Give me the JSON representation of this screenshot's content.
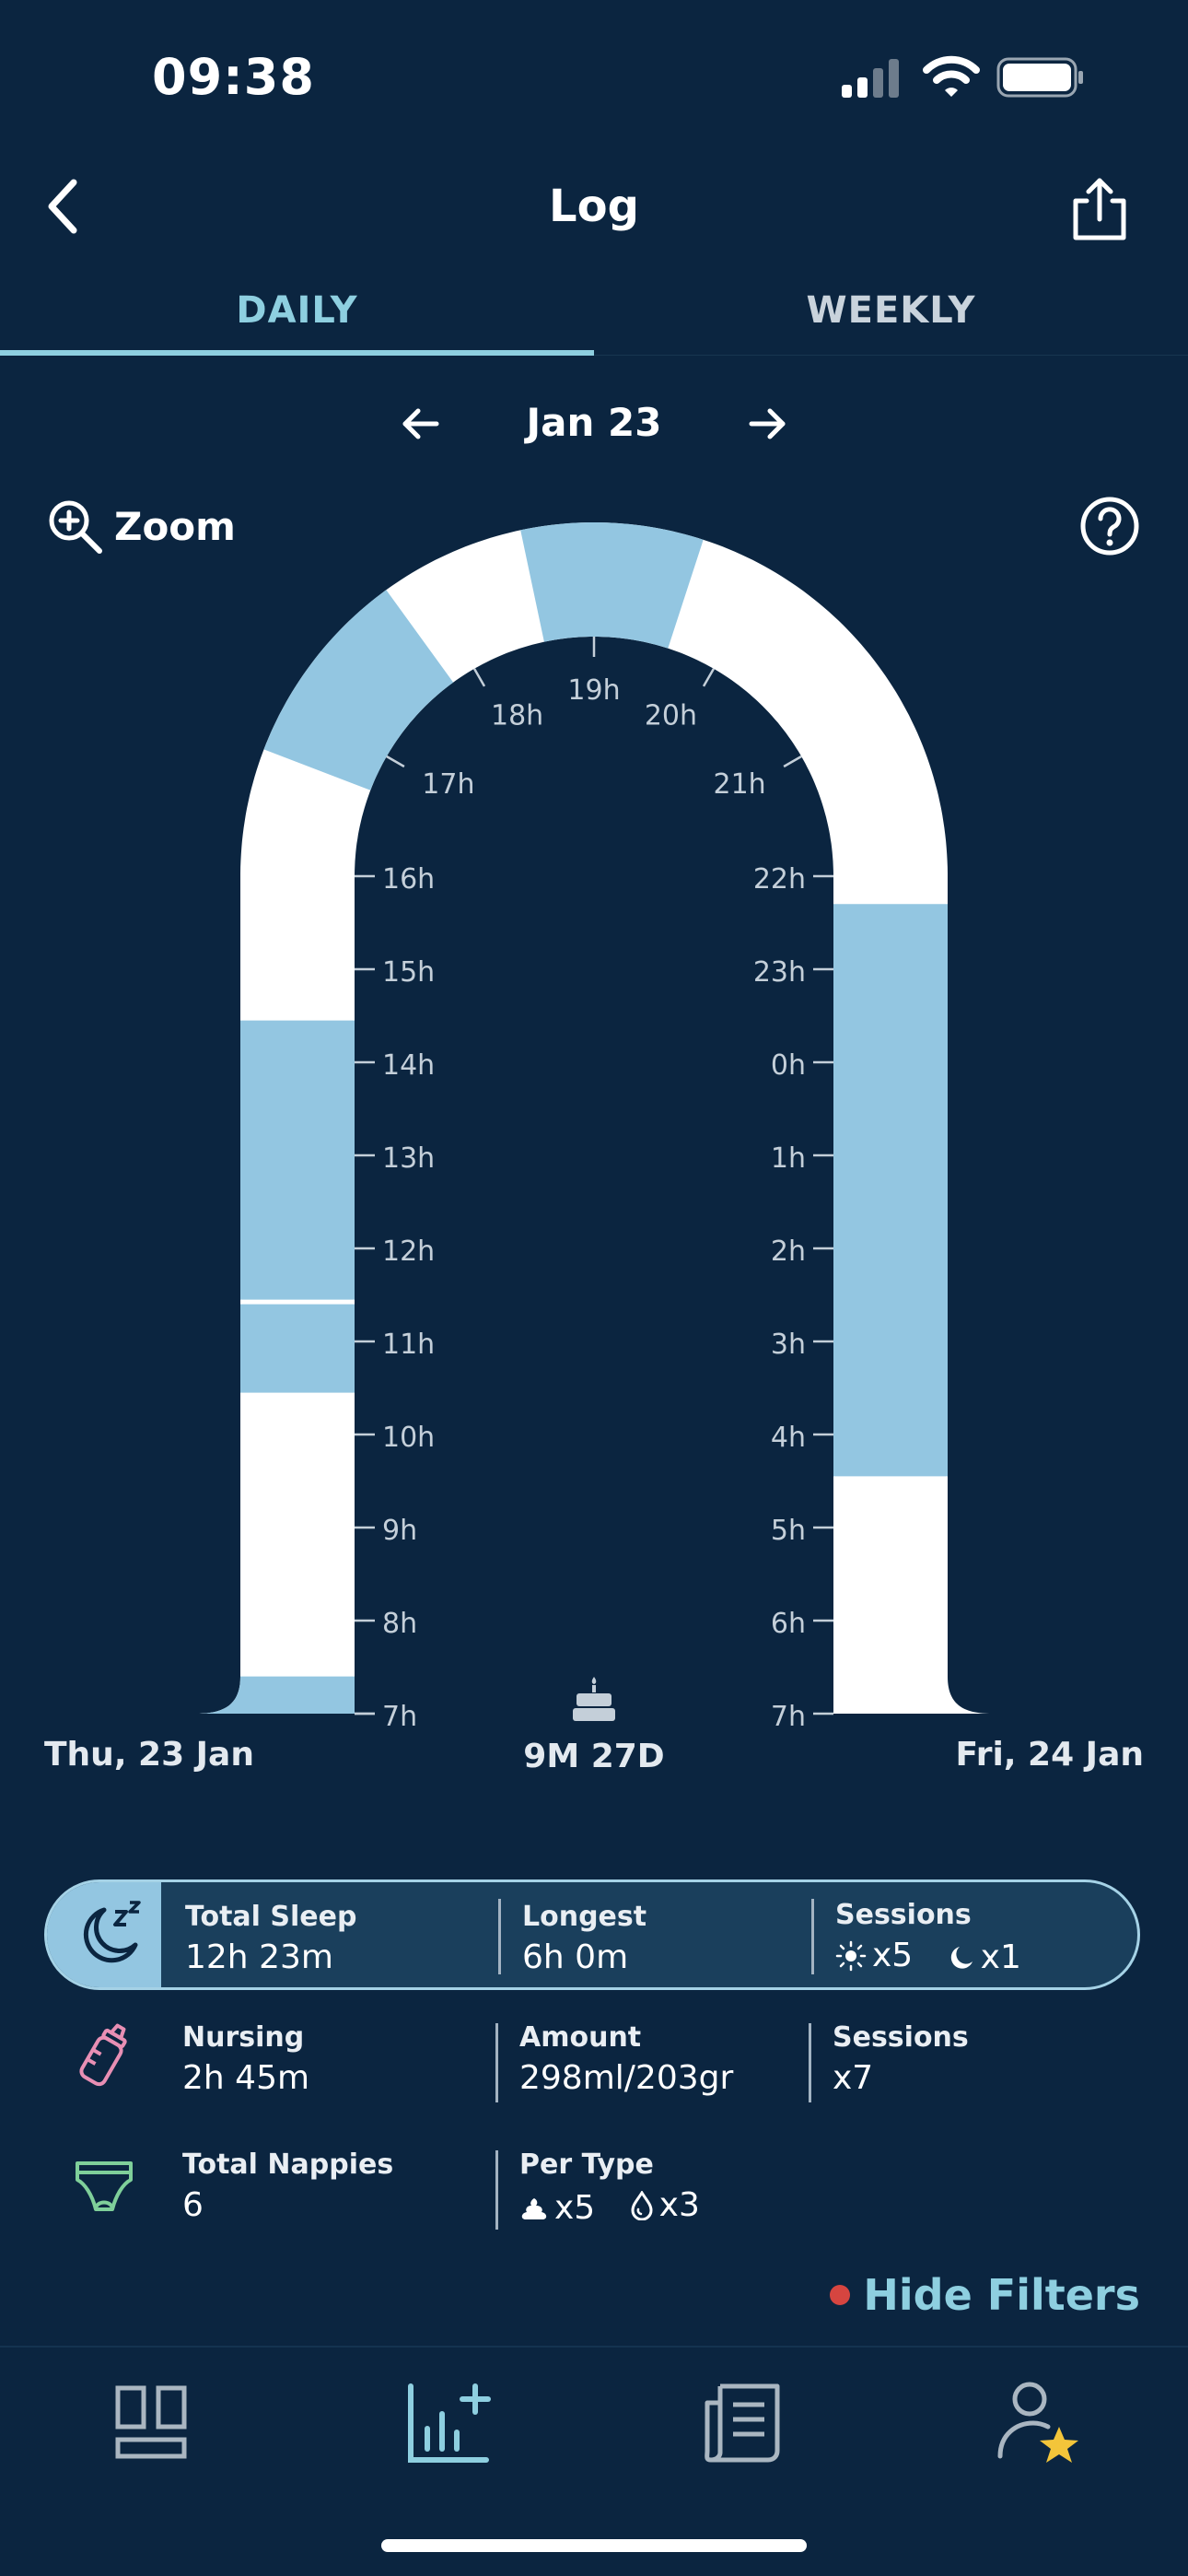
{
  "status_bar": {
    "time": "09:38"
  },
  "nav": {
    "title": "Log"
  },
  "tabs": [
    {
      "label": "DAILY",
      "active": true
    },
    {
      "label": "WEEKLY",
      "active": false
    }
  ],
  "date_nav": {
    "label": "Jan 23"
  },
  "zoom": {
    "label": "Zoom"
  },
  "chart_data": {
    "type": "arch-timeline",
    "hour_labels": [
      "7h",
      "8h",
      "9h",
      "10h",
      "11h",
      "12h",
      "13h",
      "14h",
      "15h",
      "16h",
      "17h",
      "18h",
      "19h",
      "20h",
      "21h",
      "22h",
      "23h",
      "0h",
      "1h",
      "2h",
      "3h",
      "4h",
      "5h",
      "6h",
      "7h"
    ],
    "sleep_sessions": [
      {
        "start": 7.0,
        "end": 7.4
      },
      {
        "start": 10.45,
        "end": 11.4
      },
      {
        "start": 11.45,
        "end": 14.45
      },
      {
        "start": 16.7,
        "end": 17.8
      },
      {
        "start": 18.6,
        "end": 19.6
      },
      {
        "start": 22.3,
        "end": 28.45
      }
    ],
    "start_label": "Thu, 23 Jan",
    "end_label": "Fri, 24 Jan",
    "age_label": "9M 27D",
    "colors": {
      "sleep": "#93c6e1",
      "awake": "#ffffff",
      "tick": "#c4cfd9"
    }
  },
  "summary": {
    "sleep": {
      "total_title": "Total Sleep",
      "total_value": "12h 23m",
      "longest_title": "Longest",
      "longest_value": "6h 0m",
      "sessions_title": "Sessions",
      "day_count": "x5",
      "night_count": "x1"
    },
    "nursing": {
      "title": "Nursing",
      "value": "2h 45m",
      "amount_title": "Amount",
      "amount_value": "298ml/203gr",
      "sessions_title": "Sessions",
      "sessions_value": "x7"
    },
    "nappies": {
      "title": "Total Nappies",
      "value": "6",
      "per_type_title": "Per Type",
      "poo_count": "x5",
      "wet_count": "x3"
    }
  },
  "filters": {
    "label": "Hide Filters"
  },
  "colors": {
    "background": "#0b2540",
    "accent": "#8ecfe0",
    "sleep": "#93c6e1",
    "dot": "#d64540"
  },
  "icons": [
    "back-arrow-icon",
    "share-icon",
    "arrow-left-icon",
    "arrow-right-icon",
    "zoom-in-icon",
    "help-icon",
    "cake-icon",
    "moon-zzz-icon",
    "baby-bottle-icon",
    "diaper-icon",
    "sun-icon",
    "moon-icon",
    "poo-icon",
    "drop-icon",
    "dashboard-icon",
    "chart-add-icon",
    "journal-icon",
    "profile-star-icon"
  ]
}
